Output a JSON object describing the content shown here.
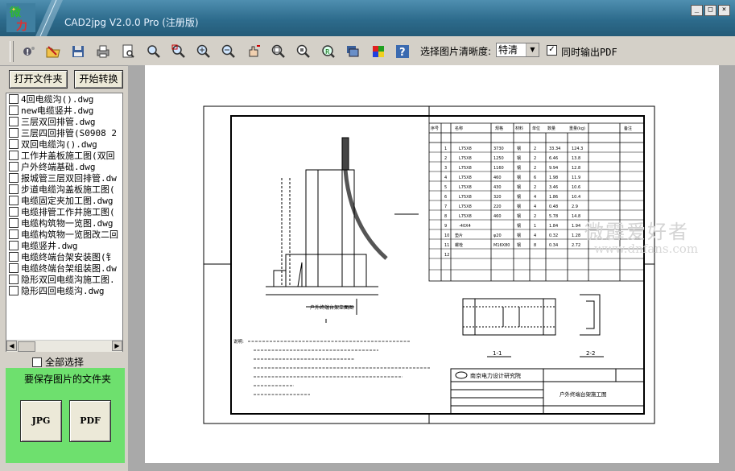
{
  "window": {
    "title": "CAD2jpg V2.0.0 Pro (注册版)",
    "logo_text": "微力",
    "controls": [
      "_",
      "□",
      "×"
    ]
  },
  "toolbar": {
    "icons": [
      "info-icon",
      "open-folder-icon",
      "save-icon",
      "print-icon",
      "print-preview-icon",
      "find-icon",
      "zoom-window-icon",
      "zoom-in-icon",
      "zoom-out-icon",
      "pan-icon",
      "zoom-extents-icon",
      "zoom-previous-icon",
      "zoom-realtime-icon",
      "layers-icon",
      "color-icon",
      "help-icon"
    ],
    "quality_label": "选择图片清晰度:",
    "quality_value": "特清",
    "pdf_checked": true,
    "pdf_label": "同时输出PDF"
  },
  "left_panel": {
    "open_folder": "打开文件夹",
    "start_convert": "开始转换",
    "files": [
      "4回电缆沟().dwg",
      "new电缆竖井.dwg",
      "三层双回排管.dwg",
      "三层四回排管(S0908 2",
      "双回电缆沟().dwg",
      "工作井盖板施工图(双回",
      "户外终端基础.dwg",
      "报城管三层双回排管.dw",
      "步道电缆沟盖板施工图(",
      "电缆固定夹加工图.dwg",
      "电缆排管工作井施工图(",
      "电缆构筑物一览图.dwg",
      "电缆构筑物一览图改二回",
      "电缆竖井.dwg",
      "电缆终端台架安装图(钅",
      "电缆终端台架组装图.dw",
      "隐形双回电缆沟施工图.",
      "隐形四回电缆沟.dwg"
    ],
    "select_all": "全部选择",
    "save_folder_label": "要保存图片的文件夹",
    "jpg_label": "JPG",
    "pdf_label": "PDF"
  },
  "preview": {
    "watermark": "微霹爱好者",
    "watermark_url": "www.dnfans.com",
    "drawing_title": "户外终端台架施工图",
    "institute": "南京电力设计研究院",
    "section_a": "1-1",
    "section_b": "2-2",
    "notes_label": "说明:",
    "table_header": [
      "序号",
      "名称",
      "规格",
      "材料",
      "单位",
      "数量",
      "重量(kg)",
      "备注"
    ],
    "table_rows": [
      [
        "1",
        "L75X8",
        "3730",
        "钢",
        "2",
        "33.34",
        "124.3",
        ""
      ],
      [
        "2",
        "L75X8",
        "1250",
        "钢",
        "2",
        "6.46",
        "13.8",
        ""
      ],
      [
        "3",
        "L75X8",
        "1160",
        "钢",
        "2",
        "9.94",
        "12.8",
        ""
      ],
      [
        "4",
        "L75X8",
        "460",
        "钢",
        "6",
        "1.98",
        "11.9",
        ""
      ],
      [
        "5",
        "L75X8",
        "430",
        "钢",
        "2",
        "3.46",
        "10.6",
        ""
      ],
      [
        "6",
        "L75X8",
        "320",
        "钢",
        "4",
        "1.86",
        "10.4",
        ""
      ],
      [
        "7",
        "L75X8",
        "220",
        "钢",
        "4",
        "0.48",
        "2.9",
        ""
      ],
      [
        "8",
        "L75X8",
        "460",
        "钢",
        "2",
        "5.78",
        "14.8",
        ""
      ],
      [
        "9",
        "-40X4",
        "",
        "钢",
        "1",
        "1.84",
        "1.94",
        ""
      ],
      [
        "10",
        "垫片",
        "φ20",
        "钢",
        "4",
        "0.32",
        "1.28",
        ""
      ],
      [
        "11",
        "螺栓",
        "M16X80",
        "钢",
        "8",
        "0.34",
        "2.72",
        ""
      ],
      [
        "12",
        "",
        "",
        "",
        "",
        "",
        "",
        ""
      ]
    ]
  }
}
